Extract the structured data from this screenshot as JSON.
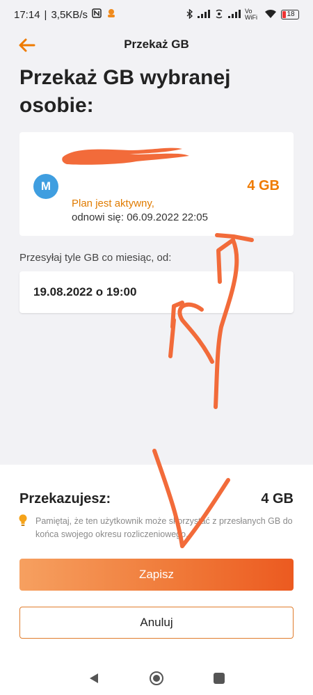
{
  "status_bar": {
    "time": "17:14",
    "network_speed": "3,5KB/s",
    "nfc_icon": "nfc-icon",
    "vowifi": "Vo WiFi",
    "battery": "18"
  },
  "header": {
    "back_icon": "arrow-left-icon",
    "title": "Przekaż GB"
  },
  "page_title": "Przekaż GB wybranej osobie:",
  "recipient": {
    "avatar_letter": "M",
    "plan_status": "Plan jest aktywny,",
    "renewal": "odnowi się: 06.09.2022 22:05",
    "gb": "4 GB"
  },
  "monthly": {
    "label": "Przesyłaj tyle GB co miesiąc, od:",
    "date": "19.08.2022 o 19:00"
  },
  "summary": {
    "label": "Przekazujesz:",
    "value": "4 GB",
    "note": "Pamiętaj, że ten użytkownik może skorzystać z przesłanych GB do końca swojego okresu rozliczeniowego."
  },
  "buttons": {
    "save": "Zapisz",
    "cancel": "Anuluj"
  },
  "colors": {
    "accent": "#ef7b00",
    "annotation": "#f26b3a",
    "avatar": "#3f9ee0"
  }
}
